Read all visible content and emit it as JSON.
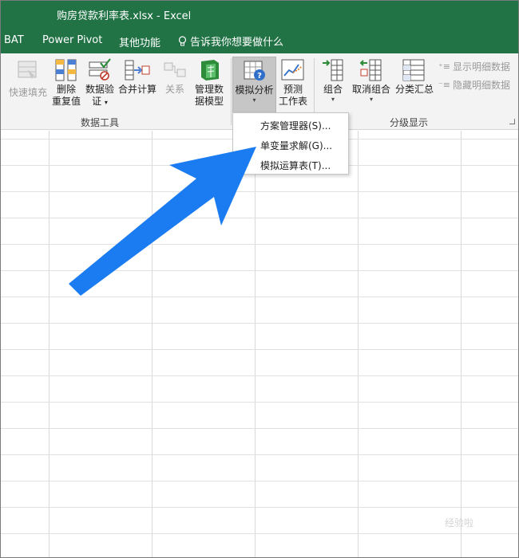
{
  "window": {
    "title": "购房贷款利率表.xlsx  -  Excel"
  },
  "tabs": [
    "BAT",
    "Power Pivot",
    "其他功能"
  ],
  "tell_me": "告诉我你想要做什么",
  "ribbon": {
    "flash_fill": "快速填充",
    "remove_dup_1": "删除",
    "remove_dup_2": "重复值",
    "validation_1": "数据验",
    "validation_2": "证",
    "consolidate": "合并计算",
    "relationships": "关系",
    "manage_model_1": "管理数",
    "manage_model_2": "据模型",
    "whatif": "模拟分析",
    "forecast_1": "预测",
    "forecast_2": "工作表",
    "group": "组合",
    "ungroup": "取消组合",
    "subtotal": "分类汇总",
    "show_detail": "显示明细数据",
    "hide_detail": "隐藏明细数据",
    "group_data_tools": "数据工具",
    "group_outline": "分级显示"
  },
  "dropdown": {
    "items": [
      "方案管理器(S)...",
      "单变量求解(G)...",
      "模拟运算表(T)..."
    ]
  },
  "watermark": "经验啦",
  "colors": {
    "excel_green": "#217346",
    "arrow_blue": "#1a7cf0"
  }
}
